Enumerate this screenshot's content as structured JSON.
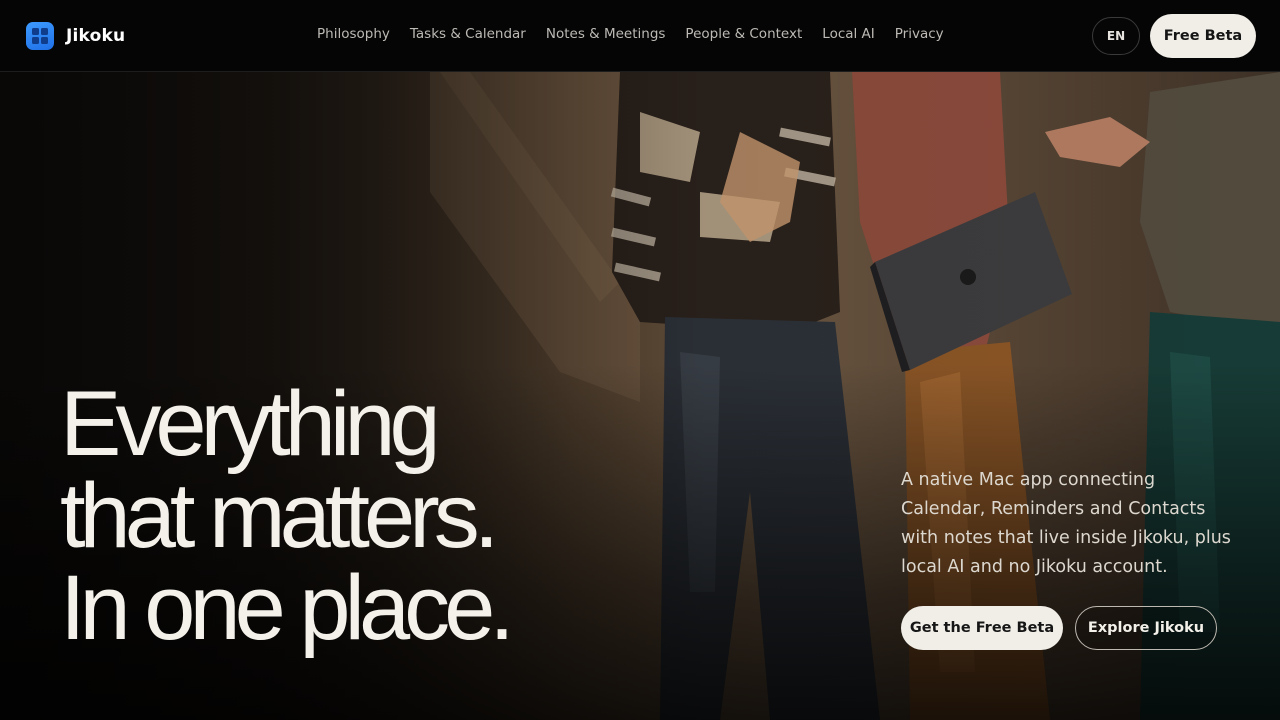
{
  "header": {
    "brand": "Jikoku",
    "logo_icon": "calendar-grid-icon",
    "nav": [
      {
        "label": "Philosophy"
      },
      {
        "label": "Tasks & Calendar"
      },
      {
        "label": "Notes & Meetings"
      },
      {
        "label": "People & Context"
      },
      {
        "label": "Local AI"
      },
      {
        "label": "Privacy"
      }
    ],
    "language": "EN",
    "cta": "Free Beta"
  },
  "hero": {
    "headline": [
      "Everything",
      "that matters.",
      "In one place."
    ],
    "lead": "A native Mac app connecting Calendar, Reminders and Contacts with notes that live inside Jikoku, plus local AI and no Jikoku account.",
    "primary_cta": "Get the Free Beta",
    "secondary_cta": "Explore Jikoku",
    "background_image": "people-with-laptop-photo"
  },
  "colors": {
    "accent": "#2b85f5",
    "button_light": "#f1eee8",
    "header_bg": "#050505"
  }
}
